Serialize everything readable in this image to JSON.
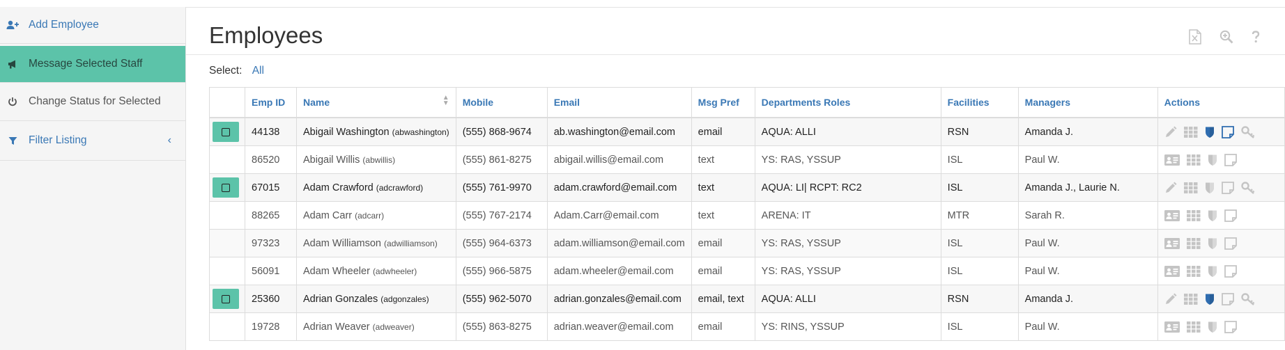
{
  "sidebar": {
    "add_employee": "Add Employee",
    "message_selected": "Message Selected Staff",
    "change_status": "Change Status for Selected",
    "filter_listing": "Filter Listing",
    "filter_chevron": "‹"
  },
  "page": {
    "title": "Employees",
    "select_label": "Select:",
    "select_all": "All"
  },
  "header_icons": [
    "excel-export-icon",
    "zoom-in-icon",
    "help-icon"
  ],
  "table": {
    "columns": [
      "Emp ID",
      "Name",
      "Mobile",
      "Email",
      "Msg Pref",
      "Departments Roles",
      "Facilities",
      "Managers",
      "Actions"
    ],
    "rows": [
      {
        "selected": true,
        "id": "44138",
        "name": "Abigail Washington",
        "user": "(abwashington)",
        "mobile": "(555) 868-9674",
        "email": "ab.washington@email.com",
        "pref": "email",
        "dept": "AQUA: ALLI",
        "facility": "RSN",
        "managers": "Amanda J."
      },
      {
        "selected": false,
        "id": "86520",
        "name": "Abigail Willis",
        "user": "(abwillis)",
        "mobile": "(555) 861-8275",
        "email": "abigail.willis@email.com",
        "pref": "text",
        "dept": "YS: RAS, YSSUP",
        "facility": "ISL",
        "managers": "Paul W."
      },
      {
        "selected": true,
        "id": "67015",
        "name": "Adam Crawford",
        "user": "(adcrawford)",
        "mobile": "(555) 761-9970",
        "email": "adam.crawford@email.com",
        "pref": "text",
        "dept": "AQUA: LI| RCPT: RC2",
        "facility": "ISL",
        "managers": "Amanda J., Laurie N."
      },
      {
        "selected": false,
        "id": "88265",
        "name": "Adam Carr",
        "user": "(adcarr)",
        "mobile": "(555) 767-2174",
        "email": "Adam.Carr@email.com",
        "pref": "text",
        "dept": "ARENA: IT",
        "facility": "MTR",
        "managers": "Sarah R."
      },
      {
        "selected": false,
        "id": "97323",
        "name": "Adam Williamson",
        "user": "(adwilliamson)",
        "mobile": "(555) 964-6373",
        "email": "adam.williamson@email.com",
        "pref": "email",
        "dept": "YS: RAS, YSSUP",
        "facility": "ISL",
        "managers": "Paul W."
      },
      {
        "selected": false,
        "id": "56091",
        "name": "Adam Wheeler",
        "user": "(adwheeler)",
        "mobile": "(555) 966-5875",
        "email": "adam.wheeler@email.com",
        "pref": "email",
        "dept": "YS: RAS, YSSUP",
        "facility": "ISL",
        "managers": "Paul W."
      },
      {
        "selected": true,
        "id": "25360",
        "name": "Adrian Gonzales",
        "user": "(adgonzales)",
        "mobile": "(555) 962-5070",
        "email": "adrian.gonzales@email.com",
        "pref": "email, text",
        "dept": "AQUA: ALLI",
        "facility": "RSN",
        "managers": "Amanda J."
      },
      {
        "selected": false,
        "id": "19728",
        "name": "Adrian Weaver",
        "user": "(adweaver)",
        "mobile": "(555) 863-8275",
        "email": "adrian.weaver@email.com",
        "pref": "email",
        "dept": "YS: RINS, YSSUP",
        "facility": "ISL",
        "managers": "Paul W."
      }
    ]
  },
  "colors": {
    "accent": "#3a78b5",
    "selected_green": "#5cc3a9",
    "sidebar_bg": "#f5f5f5",
    "icon_gray": "#c4c4c4"
  }
}
